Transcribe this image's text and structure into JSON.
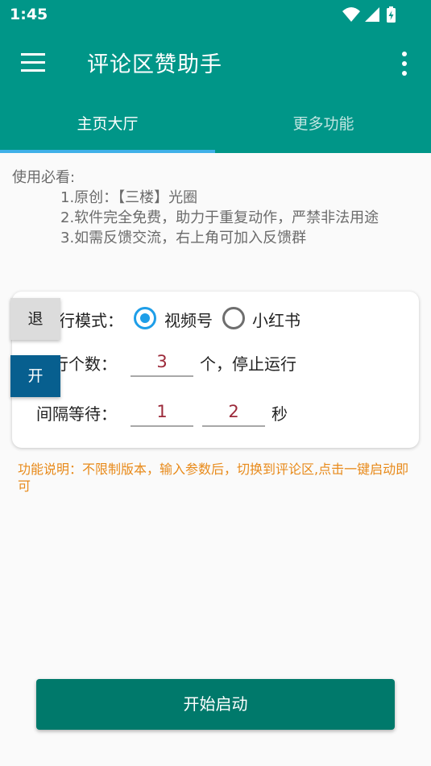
{
  "status_bar": {
    "time": "1:45",
    "icons": [
      "wifi-icon",
      "signal-icon",
      "battery-charging-icon"
    ]
  },
  "toolbar": {
    "title": "评论区赞助手",
    "menu_icon": "hamburger-menu-icon",
    "more_icon": "more-vertical-icon"
  },
  "tabs": [
    {
      "label": "主页大厅",
      "active": true
    },
    {
      "label": "更多功能",
      "active": false
    }
  ],
  "notice": {
    "heading": "使用必看:",
    "items": [
      "1.原创：【三楼】光圈",
      "2.软件完全免费，助力于重复动作，严禁非法用途",
      "3.如需反馈交流，右上角可加入反馈群"
    ]
  },
  "form": {
    "mode_label": "行模式：",
    "mode_options": [
      {
        "label": "视频号",
        "selected": true
      },
      {
        "label": "小红书",
        "selected": false
      }
    ],
    "count_label": "运行个数：",
    "count_value": "3",
    "count_suffix": "个，停止运行",
    "interval_label": "间隔等待：",
    "interval_min": "1",
    "interval_max": "2",
    "interval_unit": "秒"
  },
  "floating_buttons": {
    "exit_label": "退",
    "open_label": "开"
  },
  "function_note": "功能说明：不限制版本，输入参数后，切换到评论区,点击一键启动即可",
  "start_button": "开始启动",
  "colors": {
    "primary": "#009688",
    "tab_indicator": "#3fb0e8",
    "radio_accent": "#1e9ee8",
    "note_orange": "#e88a1a",
    "start_button": "#00796b",
    "open_button": "#075f8f"
  }
}
